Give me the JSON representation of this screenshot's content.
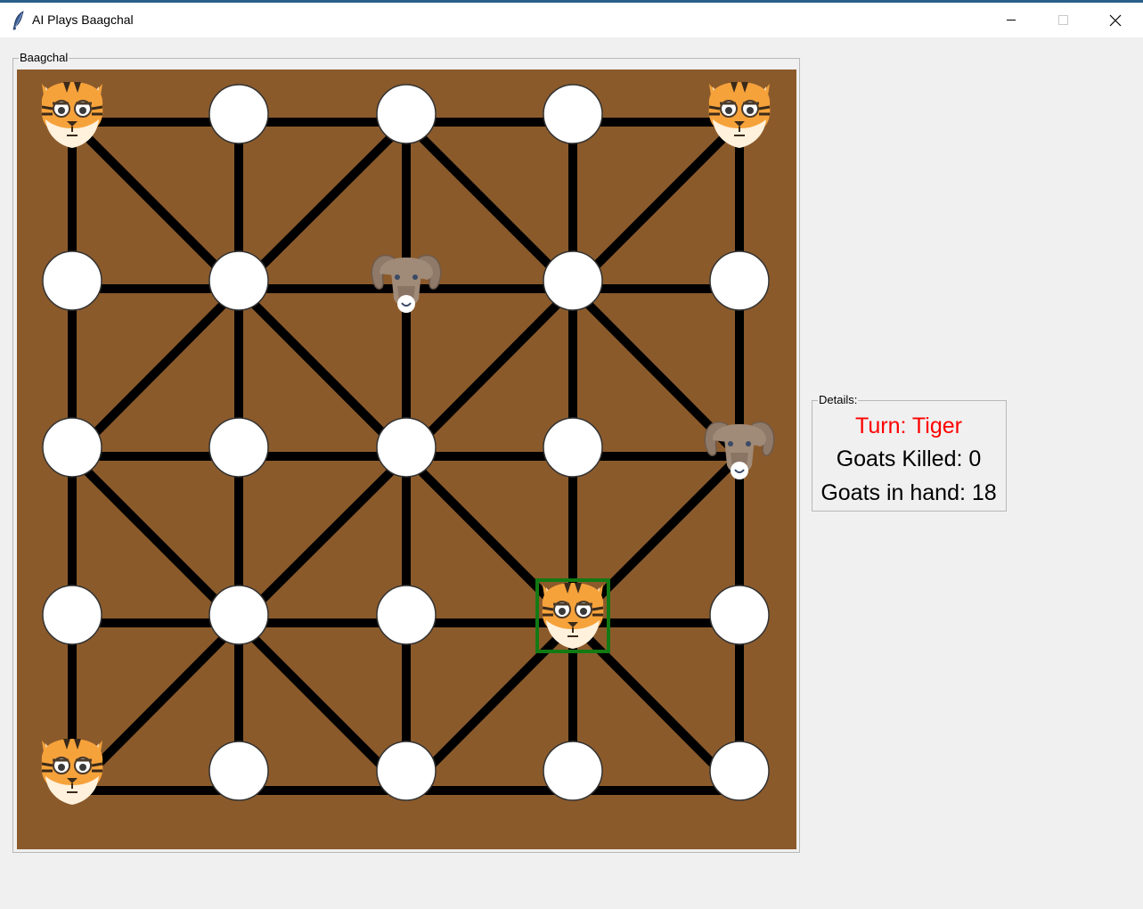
{
  "window": {
    "title": "AI Plays Baagchal",
    "icon": "feather-icon",
    "controls": [
      "minimize",
      "maximize",
      "close"
    ]
  },
  "board": {
    "frame_label": "Baagchal",
    "background_color": "#8b5a2b",
    "line_color": "#000000",
    "highlight_color": "#137a13",
    "size": 5,
    "cells": [
      [
        "tiger",
        "empty",
        "empty",
        "empty",
        "tiger"
      ],
      [
        "empty",
        "empty",
        "goat",
        "empty",
        "empty"
      ],
      [
        "empty",
        "empty",
        "empty",
        "empty",
        "goat"
      ],
      [
        "empty",
        "empty",
        "empty",
        "tiger",
        "empty"
      ],
      [
        "tiger",
        "empty",
        "empty",
        "empty",
        "empty"
      ]
    ],
    "selected": [
      3,
      3
    ]
  },
  "details": {
    "frame_label": "Details:",
    "turn": "Turn: Tiger",
    "turn_color": "#ff0000",
    "goats_killed": "Goats Killed: 0",
    "goats_in_hand": "Goats in hand: 18"
  }
}
